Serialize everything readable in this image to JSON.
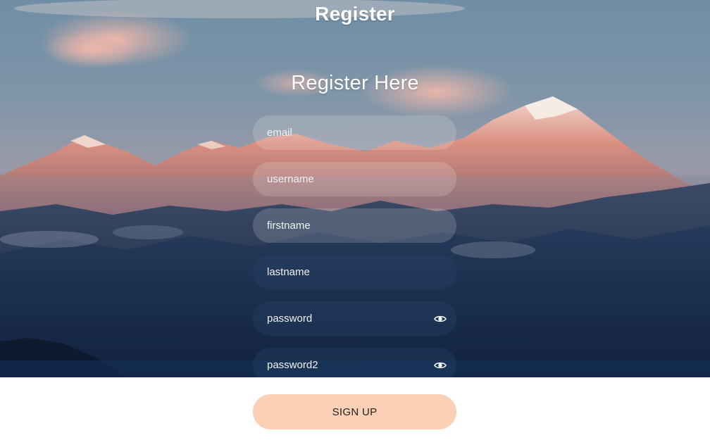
{
  "page": {
    "title": "Register",
    "heading": "Register Here"
  },
  "form": {
    "fields": [
      {
        "name": "email",
        "placeholder": "email",
        "type": "text"
      },
      {
        "name": "username",
        "placeholder": "username",
        "type": "text"
      },
      {
        "name": "firstname",
        "placeholder": "firstname",
        "type": "text"
      },
      {
        "name": "lastname",
        "placeholder": "lastname",
        "type": "text"
      },
      {
        "name": "password",
        "placeholder": "password",
        "type": "password",
        "icon": "eye-icon"
      },
      {
        "name": "password2",
        "placeholder": "password2",
        "type": "password",
        "icon": "eye-icon"
      }
    ],
    "submit_label": "SIGN UP"
  },
  "colors": {
    "button_bg": "#fccfb7",
    "text": "#ffffff"
  }
}
